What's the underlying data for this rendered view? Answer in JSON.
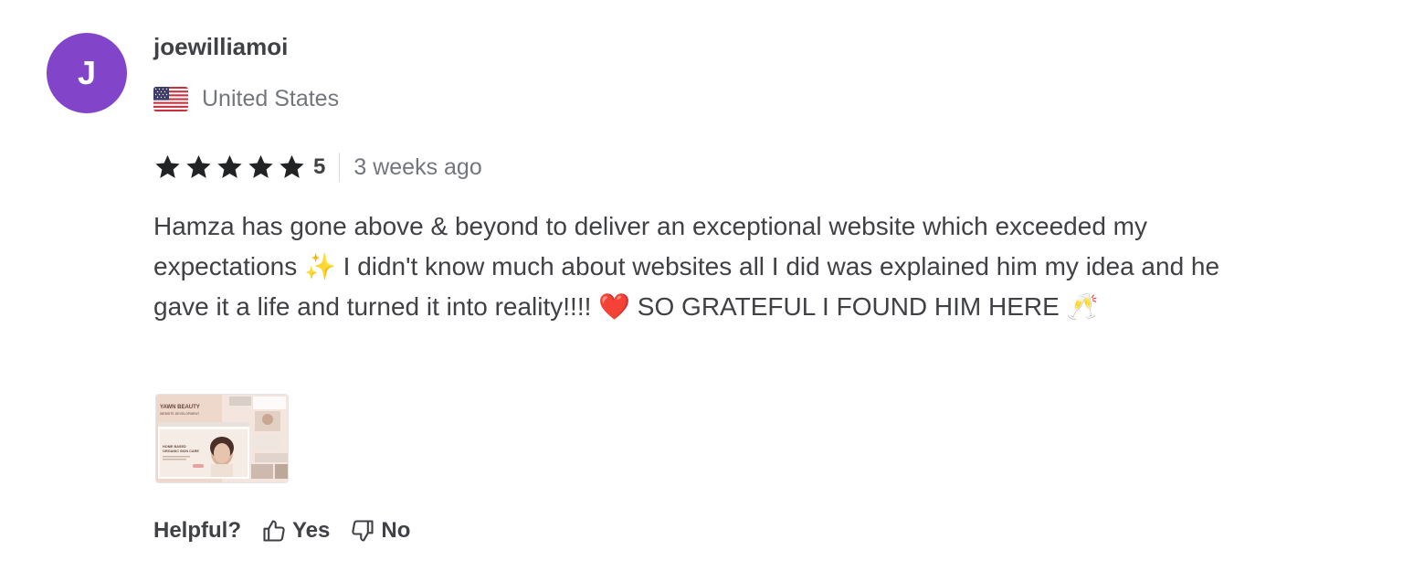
{
  "reviewer": {
    "avatar_initial": "J",
    "avatar_color": "#8245c9",
    "username": "joewilliamoi",
    "country": "United States",
    "flag_icon": "us-flag-icon"
  },
  "rating": {
    "stars": 5,
    "value": "5",
    "time_ago": "3 weeks ago",
    "star_icon": "star-icon"
  },
  "review": {
    "text": "Hamza has gone above & beyond to deliver an exceptional website which exceeded my expectations ✨ I didn't know much about websites all I did was explained him my idea and he gave it a life and turned it into reality!!!! ❤️ SO GRATEFUL I FOUND HIM HERE 🥂"
  },
  "attachment": {
    "title_line1": "YAWN BEAUTY",
    "title_line2": "WEBSITE DEVELOPMENT",
    "hero_line1": "HOME BASED",
    "hero_line2": "ORGANIC SKIN CARE"
  },
  "helpful": {
    "label": "Helpful?",
    "yes_label": "Yes",
    "no_label": "No"
  }
}
